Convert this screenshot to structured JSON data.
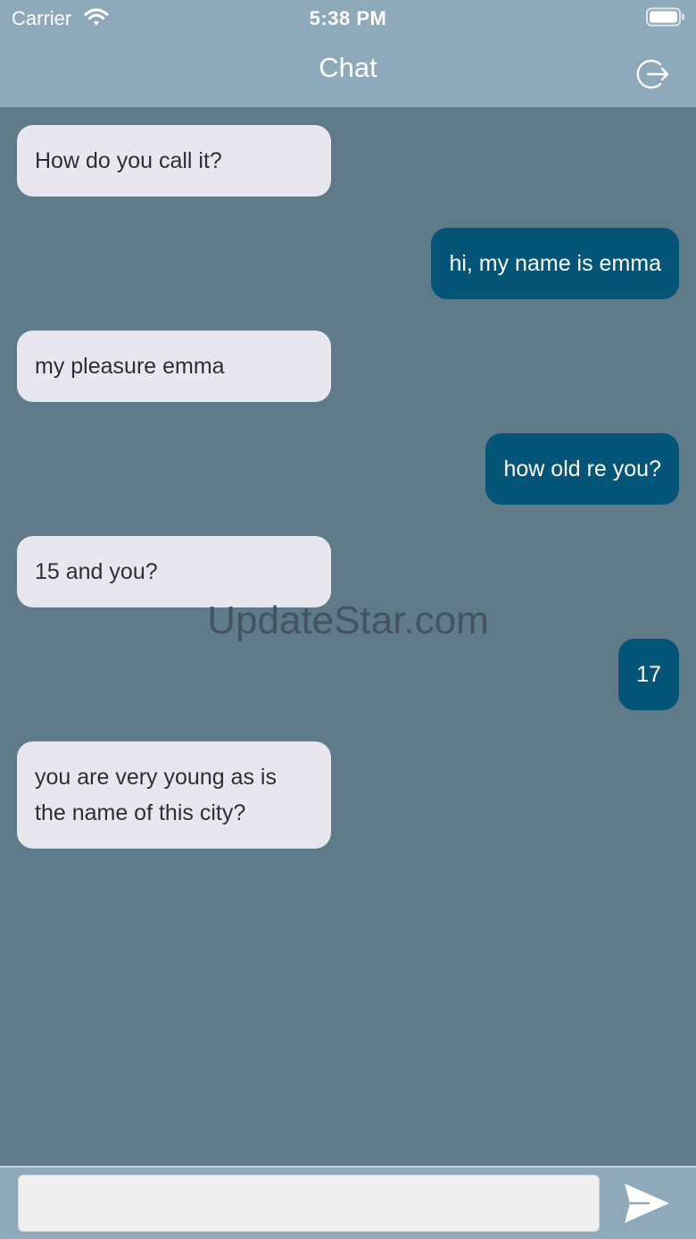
{
  "status_bar": {
    "carrier": "Carrier",
    "time": "5:38 PM",
    "wifi_icon": "wifi-icon",
    "battery_icon": "battery-full-icon"
  },
  "header": {
    "title": "Chat",
    "logout_icon": "logout-icon"
  },
  "messages": [
    {
      "sender": "other",
      "text": "How do you call it?"
    },
    {
      "sender": "me",
      "text": "hi, my name is emma"
    },
    {
      "sender": "other",
      "text": "my pleasure emma"
    },
    {
      "sender": "me",
      "text": "how old re you?"
    },
    {
      "sender": "other",
      "text": "15 and you?"
    },
    {
      "sender": "me",
      "text": "17"
    },
    {
      "sender": "other",
      "text": "you are very young as is the name of this city?"
    }
  ],
  "watermark": "UpdateStar.com",
  "composer": {
    "value": "",
    "placeholder": "",
    "send_icon": "send-icon"
  },
  "colors": {
    "header_bg": "#8eaaba",
    "chat_bg": "#5f7b89",
    "incoming_bubble": "#e8e7ee",
    "outgoing_bubble": "#045577"
  }
}
